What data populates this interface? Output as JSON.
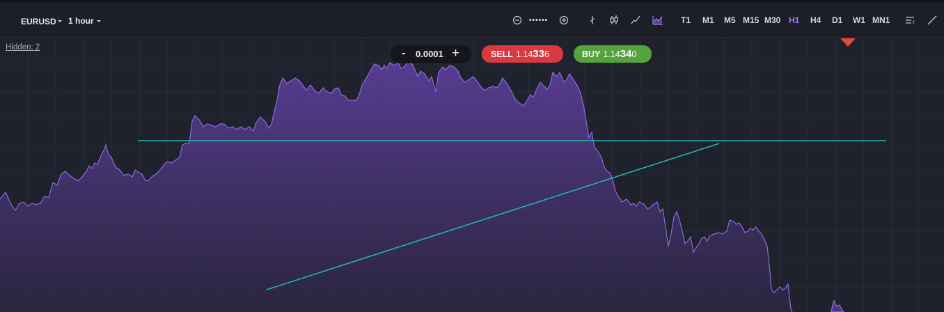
{
  "toolbar": {
    "symbol": "EURUSD",
    "interval": "1 hour",
    "zoom_dots": "••••••",
    "timeframes": [
      "T1",
      "M1",
      "M5",
      "M15",
      "M30",
      "H1",
      "H4",
      "D1",
      "W1",
      "MN1"
    ],
    "active_timeframe": "H1",
    "icons": [
      "zoom-out-icon",
      "zoom-in-icon",
      "tick-chart-icon",
      "candlestick-icon",
      "line-chart-icon",
      "area-chart-icon",
      "indicators-icon",
      "drawing-tool-icon"
    ]
  },
  "chart": {
    "hidden_label": "Hidden: 2",
    "step": {
      "minus": "-",
      "value": "0.0001",
      "plus": "+"
    },
    "sell": {
      "label": "SELL",
      "price_main": "1.14",
      "price_big": "33",
      "price_small": "6"
    },
    "buy": {
      "label": "BUY",
      "price_main": "1.14",
      "price_big": "34",
      "price_small": "0"
    },
    "colors": {
      "background": "#1f212c",
      "grid": "#2a2d39",
      "area_line": "#8b6de0",
      "area_fill_top": "#5a3d96",
      "area_fill_bottom": "#2b2640",
      "trend_line": "#26b3ad",
      "sell": "#d9393f",
      "buy": "#54a33c",
      "marker": "#e14a37"
    }
  }
}
